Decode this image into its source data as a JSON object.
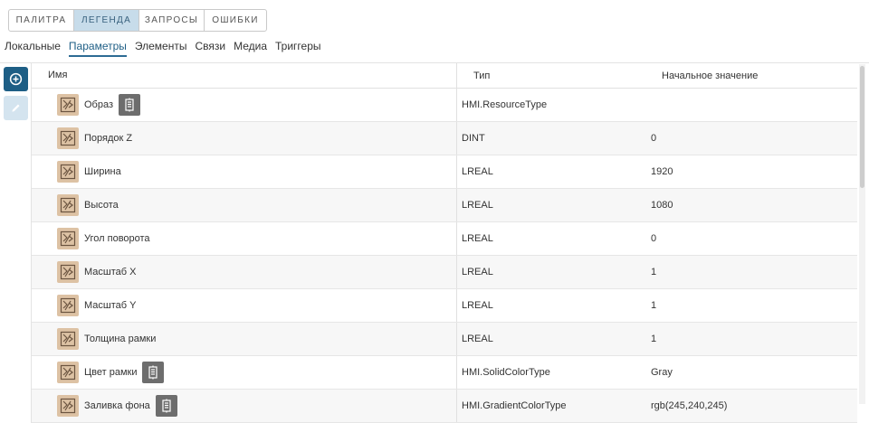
{
  "top_tabs": [
    {
      "label": "ПАЛИТРА",
      "active": false
    },
    {
      "label": "ЛЕГЕНДА",
      "active": true
    },
    {
      "label": "ЗАПРОСЫ",
      "active": false
    },
    {
      "label": "ОШИБКИ",
      "active": false
    }
  ],
  "sub_tabs": [
    {
      "label": "Локальные",
      "active": false
    },
    {
      "label": "Параметры",
      "active": true
    },
    {
      "label": "Элементы",
      "active": false
    },
    {
      "label": "Связи",
      "active": false
    },
    {
      "label": "Медиа",
      "active": false
    },
    {
      "label": "Триггеры",
      "active": false
    }
  ],
  "side_actions": {
    "add_icon": "plus-circle-icon",
    "edit_icon": "pencil-icon"
  },
  "table": {
    "columns": {
      "name": "Имя",
      "type": "Тип",
      "initial": "Начальное значение"
    },
    "rows": [
      {
        "name": "Образ",
        "type": "HMI.ResourceType",
        "initial": "",
        "has_doc": true
      },
      {
        "name": "Порядок Z",
        "type": "DINT",
        "initial": "0",
        "has_doc": false
      },
      {
        "name": "Ширина",
        "type": "LREAL",
        "initial": "1920",
        "has_doc": false
      },
      {
        "name": "Высота",
        "type": "LREAL",
        "initial": "1080",
        "has_doc": false
      },
      {
        "name": "Угол поворота",
        "type": "LREAL",
        "initial": "0",
        "has_doc": false
      },
      {
        "name": "Масштаб X",
        "type": "LREAL",
        "initial": "1",
        "has_doc": false
      },
      {
        "name": "Масштаб Y",
        "type": "LREAL",
        "initial": "1",
        "has_doc": false
      },
      {
        "name": "Толщина рамки",
        "type": "LREAL",
        "initial": "1",
        "has_doc": false
      },
      {
        "name": "Цвет рамки",
        "type": "HMI.SolidColorType",
        "initial": "Gray",
        "has_doc": true
      },
      {
        "name": "Заливка фона",
        "type": "HMI.GradientColorType",
        "initial": "rgb(245,240,245)",
        "has_doc": true
      }
    ]
  },
  "colors": {
    "accent": "#1d5e85",
    "active_tab_bg": "#c7dcea",
    "param_icon_bg": "#ddc2a4",
    "doc_button_bg": "#6d6d6d"
  }
}
